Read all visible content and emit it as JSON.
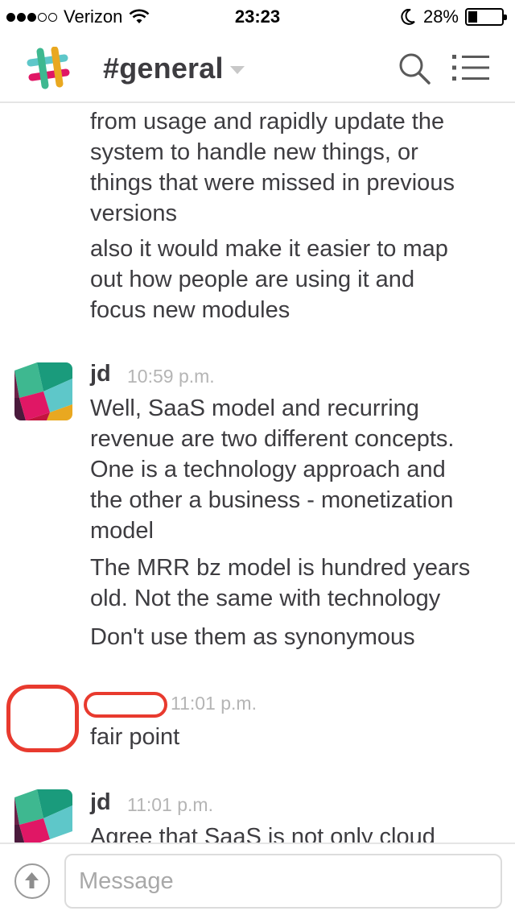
{
  "status_bar": {
    "carrier": "Verizon",
    "time": "23:23",
    "battery_percent": "28%",
    "battery_level": 0.28,
    "signal_bars_filled": 3,
    "signal_bars_total": 5
  },
  "header": {
    "channel_name": "#general",
    "icons": [
      "slack-logo-icon",
      "chevron-down-icon",
      "search-icon",
      "menu-icon"
    ]
  },
  "messages": {
    "continuation_lines": [
      "from usage and rapidly update the",
      "system to handle new things, or",
      "things that were missed in previous",
      "versions"
    ],
    "continuation_2": [
      "also it would make it easier to map",
      "out how people are using it and",
      "focus new modules"
    ],
    "msg1": {
      "author": "jd",
      "time": "10:59 p.m.",
      "block1": [
        "Well, SaaS model and recurring",
        "revenue are two different concepts.",
        "One is a technology approach and",
        "the other a business - monetization",
        "model"
      ],
      "block2": [
        "The MRR bz model is hundred years",
        "old. Not the same with technology"
      ],
      "block3": "Don't use them as synonymous"
    },
    "msg2": {
      "time": "11:01 p.m.",
      "text": "fair point"
    },
    "msg3": {
      "author": "jd",
      "time": "11:01 p.m.",
      "text": "Agree that SaaS is not only cloud"
    }
  },
  "composer": {
    "placeholder": "Message"
  },
  "colors": {
    "accent_red": "#e83a2e",
    "text": "#3d3c40",
    "muted": "#b5b5b5"
  }
}
